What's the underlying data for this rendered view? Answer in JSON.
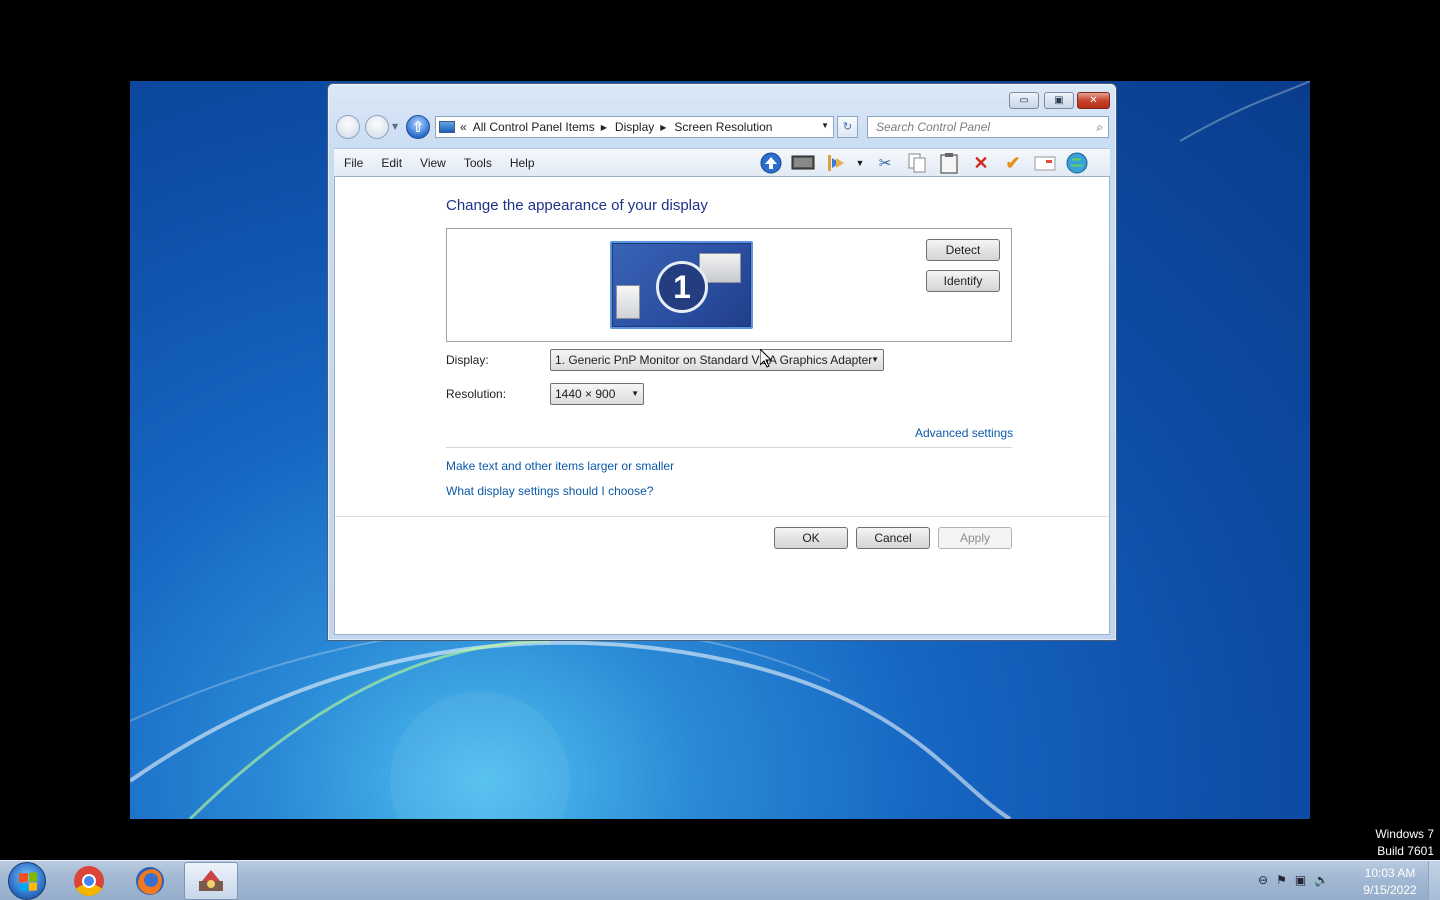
{
  "window": {
    "min_glyph": "▭",
    "max_glyph": "▣",
    "close_glyph": "✕"
  },
  "address": {
    "overflow": "«",
    "crumbs": [
      "All Control Panel Items",
      "Display",
      "Screen Resolution"
    ],
    "separator": "▶",
    "dropdown": "▼",
    "refresh_glyph": "↻",
    "up_glyph": "⇧"
  },
  "search": {
    "placeholder": "Search Control Panel",
    "icon_glyph": "⌕"
  },
  "menu": [
    "File",
    "Edit",
    "View",
    "Tools",
    "Help"
  ],
  "toolbar_icons": [
    "up-arrow-icon",
    "monitor-icon",
    "fast-forward-icon",
    "dropdown-icon",
    "scissors-icon",
    "copy-icon",
    "clipboard-icon",
    "delete-icon",
    "checkmark-icon",
    "mail-icon",
    "globe-icon"
  ],
  "content": {
    "heading": "Change the appearance of your display",
    "monitor_number": "1",
    "detect_label": "Detect",
    "identify_label": "Identify",
    "display_label": "Display:",
    "display_value": "1. Generic PnP Monitor on Standard VGA Graphics Adapter",
    "resolution_label": "Resolution:",
    "resolution_value": "1440 × 900",
    "advanced_link": "Advanced settings",
    "text_size_link": "Make text and other items larger or smaller",
    "help_link": "What display settings should I choose?",
    "ok_label": "OK",
    "cancel_label": "Cancel",
    "apply_label": "Apply"
  },
  "watermark": {
    "line1": "Windows 7",
    "line2": "Build 7601"
  },
  "taskbar": {
    "apps": [
      "chrome-icon",
      "firefox-icon",
      "app-icon"
    ],
    "clock_time": "10:03 AM",
    "clock_date": "9/15/2022"
  },
  "colors": {
    "desktop": "#1666c2",
    "link": "#0b5aa8",
    "heading": "#1e3287",
    "close": "#c7432c"
  }
}
